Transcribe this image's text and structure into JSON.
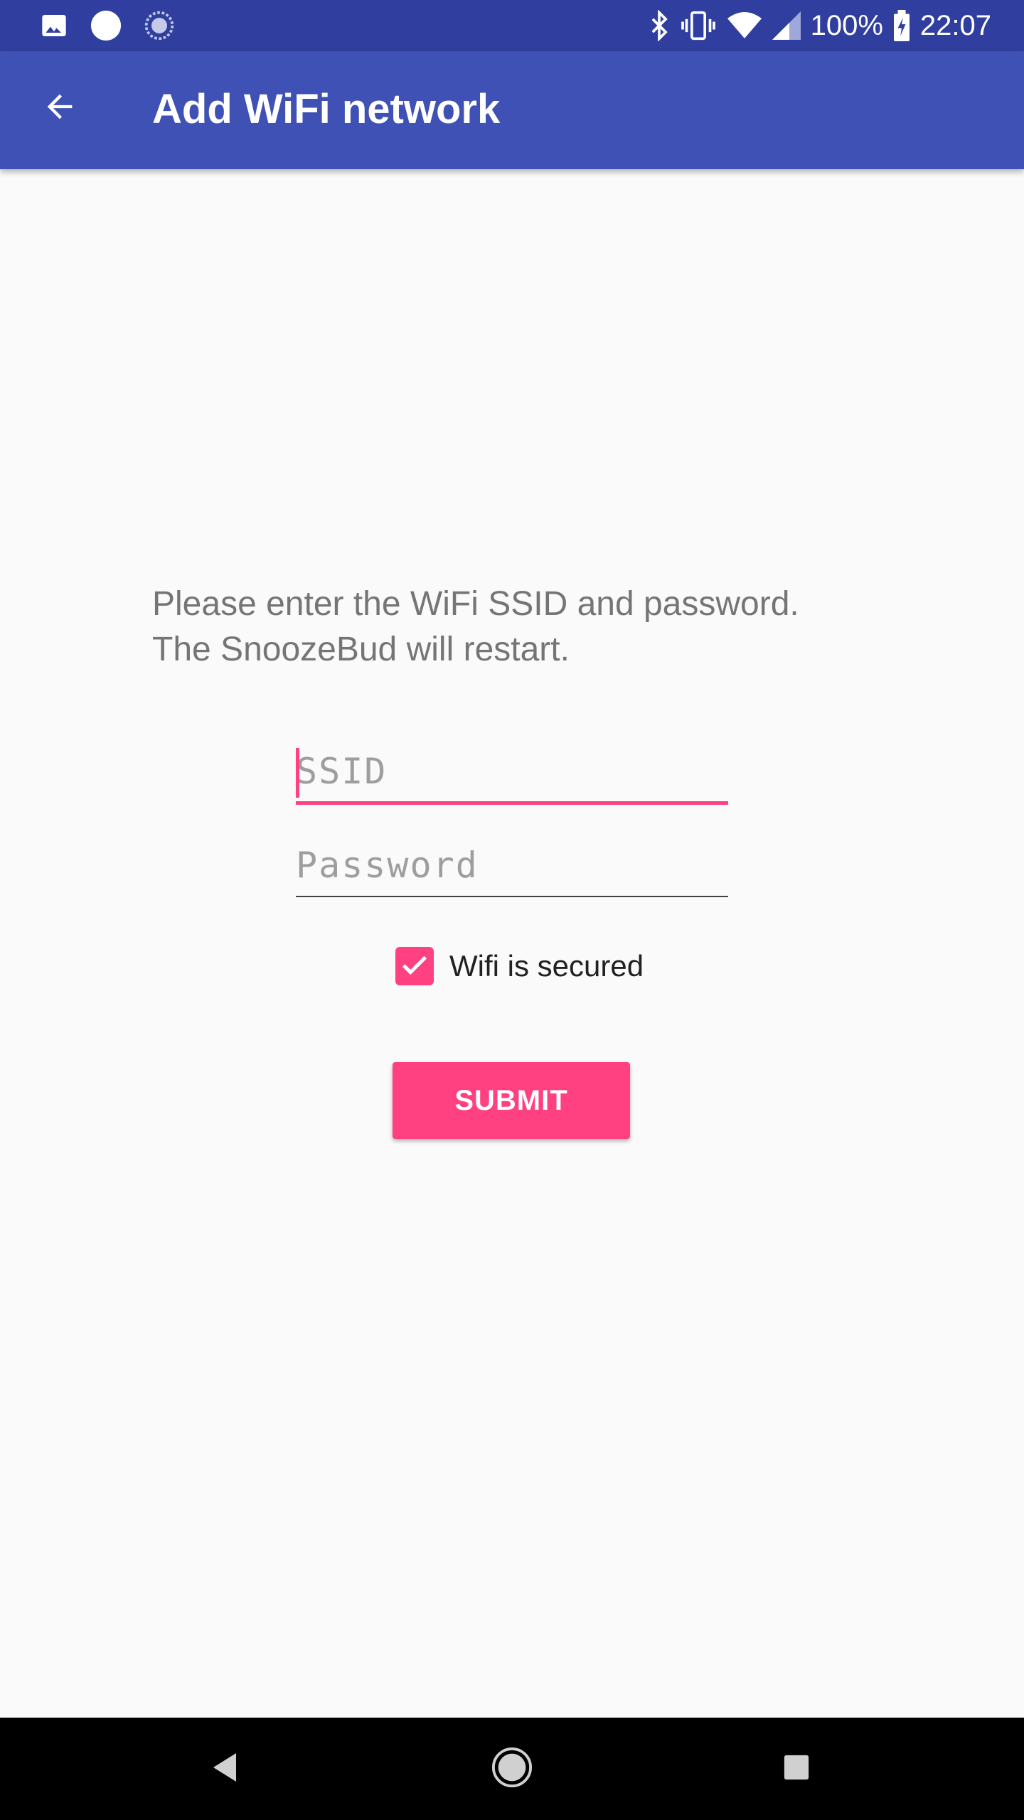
{
  "status_bar": {
    "battery": "100%",
    "time": "22:07",
    "icons": [
      "image-notification-icon",
      "circle-notification-icon",
      "sync-notification-icon",
      "bluetooth-icon",
      "vibrate-icon",
      "wifi-icon",
      "cell-signal-icon",
      "battery-charging-icon"
    ]
  },
  "app_bar": {
    "title": "Add WiFi network",
    "back_icon": "arrow-back-icon"
  },
  "main": {
    "instructions_line1": "Please enter the WiFi SSID and password.",
    "instructions_line2": "The SnoozeBud will restart.",
    "ssid": {
      "placeholder": "SSID",
      "value": ""
    },
    "password": {
      "placeholder": "Password",
      "value": ""
    },
    "secured_checkbox": {
      "label": "Wifi is secured",
      "checked": true
    },
    "submit_label": "SUBMIT"
  },
  "nav_bar": {
    "icons": [
      "nav-back-icon",
      "nav-home-icon",
      "nav-recents-icon"
    ]
  },
  "colors": {
    "status_bar": "#303f9f",
    "primary": "#3f51b5",
    "accent": "#ff4081",
    "background": "#fafafa",
    "text_secondary": "#757575"
  }
}
